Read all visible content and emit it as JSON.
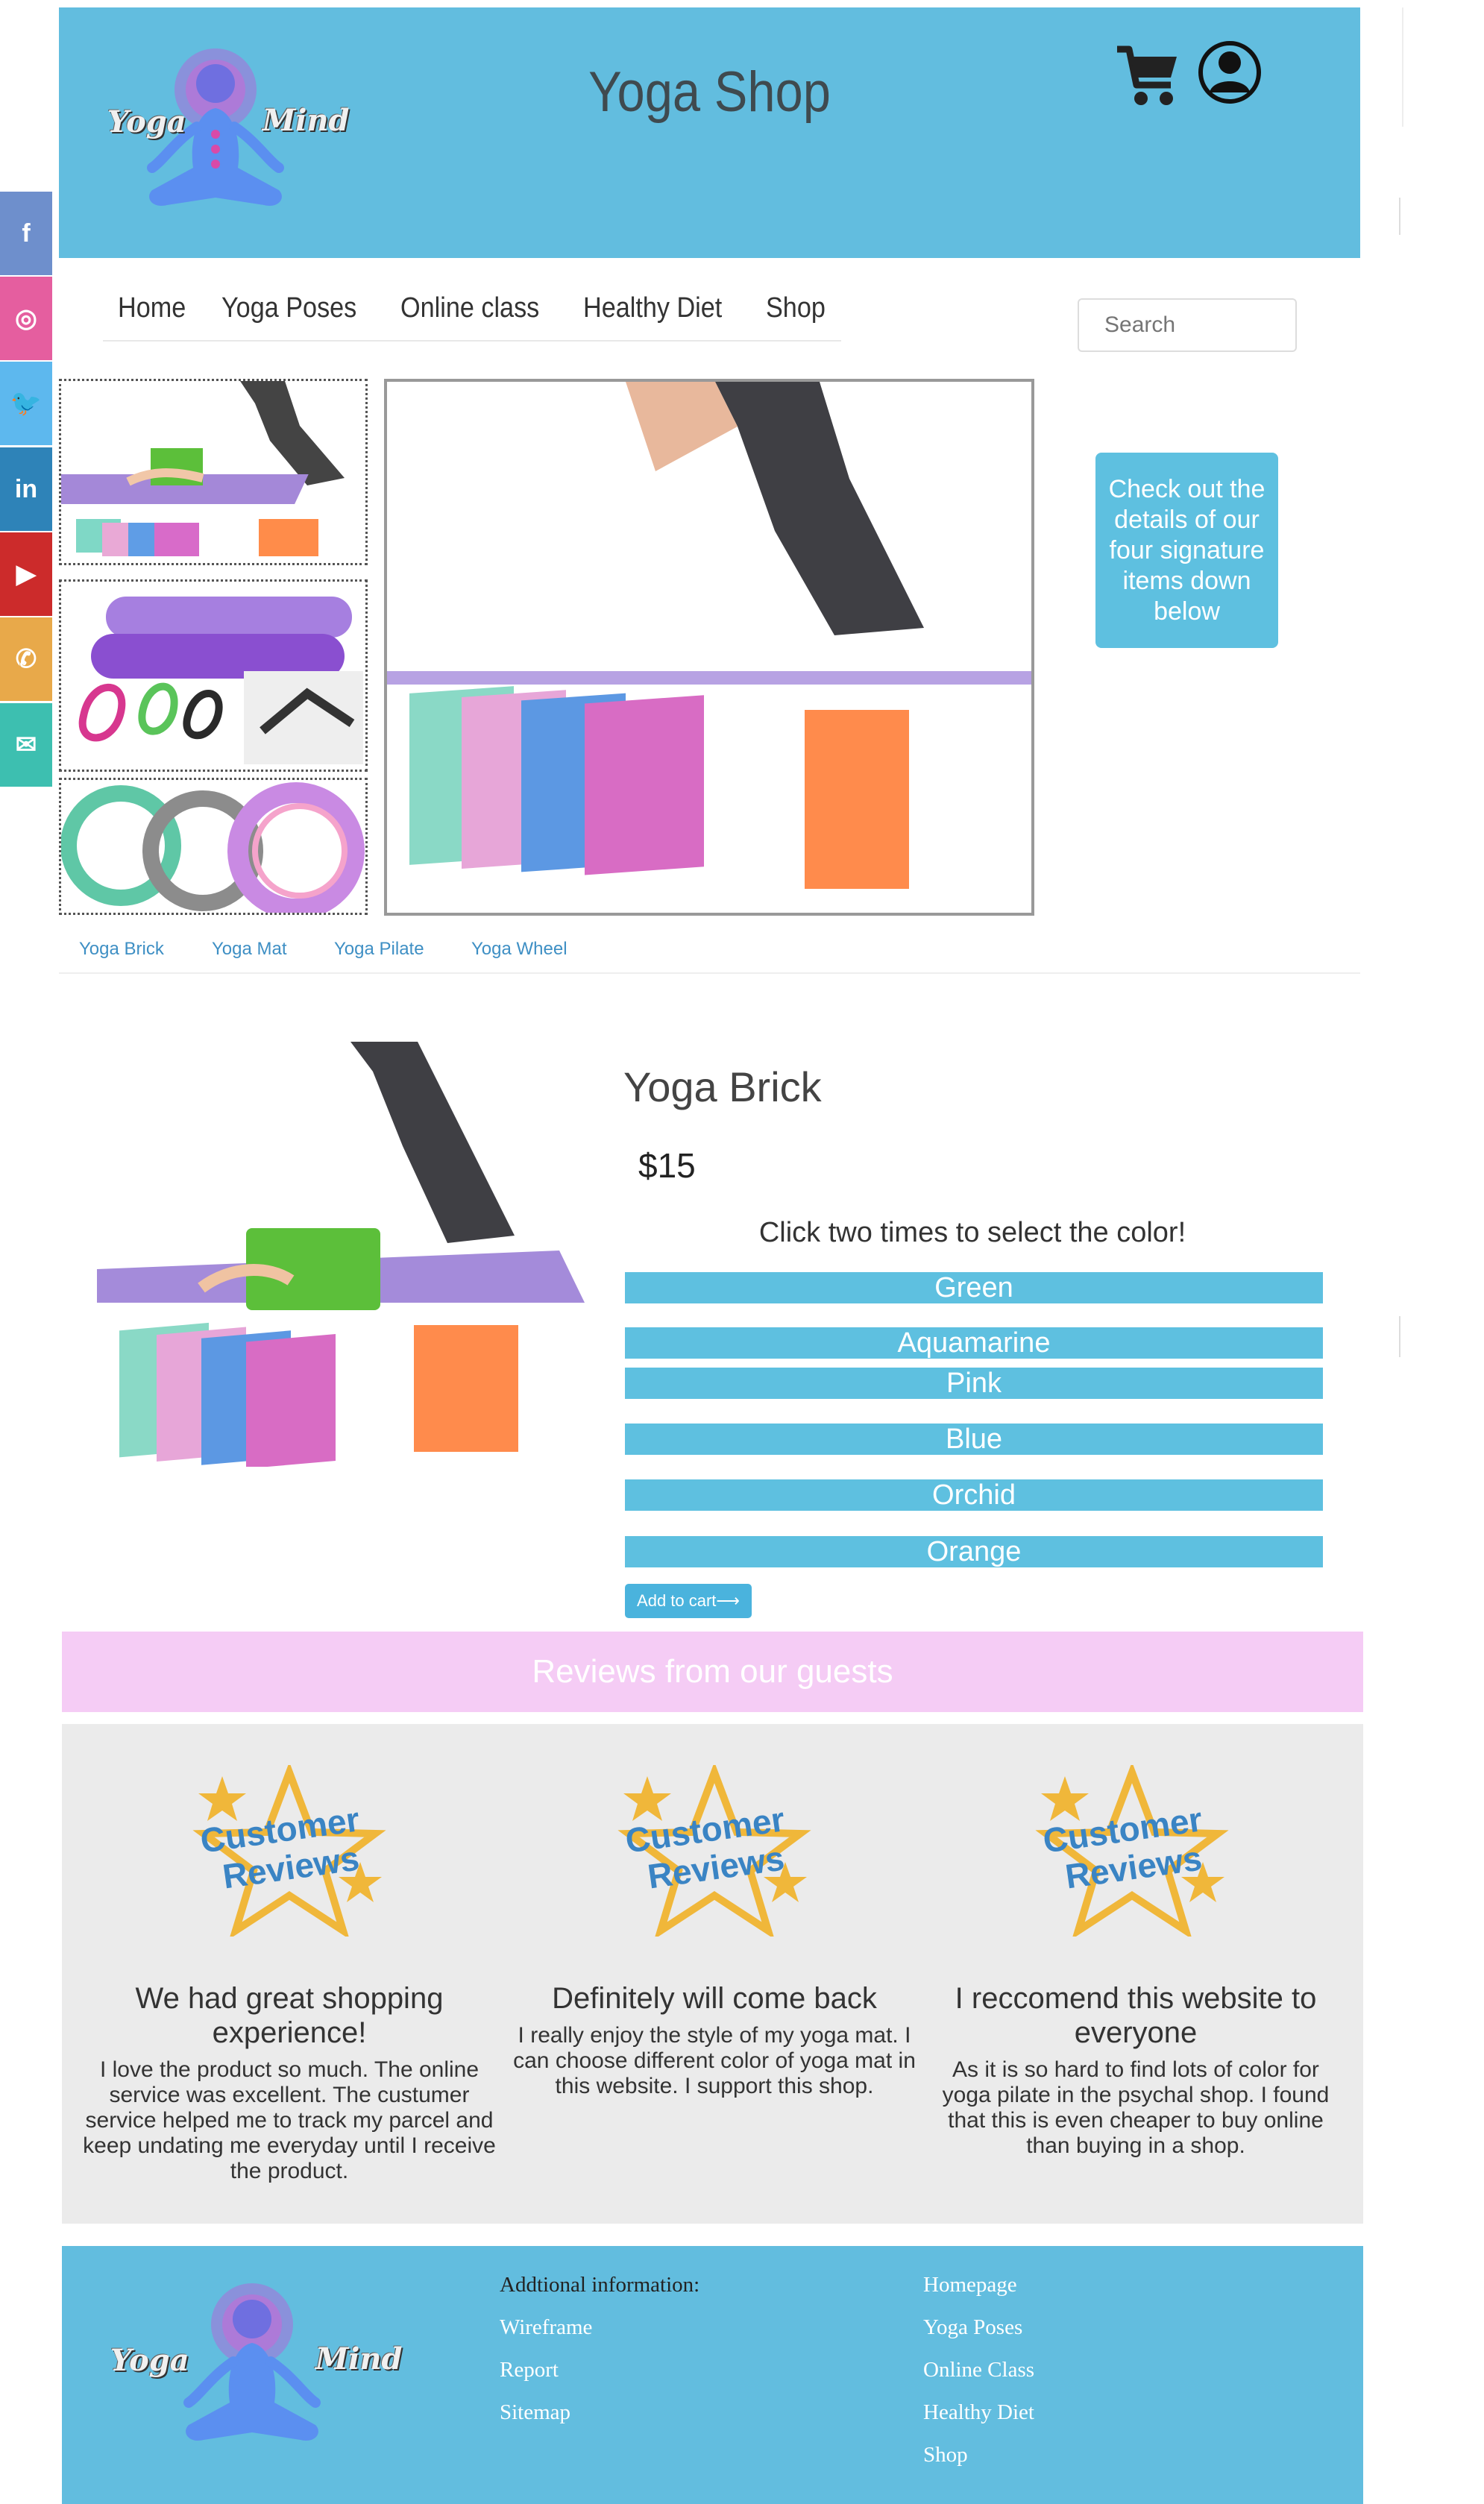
{
  "header": {
    "title": "Yoga Shop",
    "logo_left": "Yoga",
    "logo_right": "Mind",
    "cart_icon": "cart-icon",
    "user_icon": "user-icon",
    "brand_color": "#62bddf"
  },
  "social": [
    {
      "name": "facebook",
      "glyph": "f",
      "color": "#6e8fcc"
    },
    {
      "name": "instagram",
      "glyph": "◎",
      "color": "#e55e9f"
    },
    {
      "name": "twitter",
      "glyph": "🐦",
      "color": "#5db8ee"
    },
    {
      "name": "linkedin",
      "glyph": "in",
      "color": "#2e83b8"
    },
    {
      "name": "youtube",
      "glyph": "▶",
      "color": "#cc2b2b"
    },
    {
      "name": "phone",
      "glyph": "✆",
      "color": "#e8a94a"
    },
    {
      "name": "email",
      "glyph": "✉",
      "color": "#3dbfb0"
    }
  ],
  "nav": {
    "items": [
      "Home",
      "Yoga Poses",
      "Online class",
      "Healthy Diet",
      "Shop"
    ],
    "search_placeholder": "Search"
  },
  "gallery": {
    "info_box": "Check out the details of our four signature items down below",
    "tabs": [
      "Yoga Brick",
      "Yoga Mat",
      "Yoga Pilate",
      "Yoga Wheel"
    ]
  },
  "product": {
    "title": "Yoga Brick",
    "price": "$15",
    "color_hint": "Click two times to select the color!",
    "colors": [
      "Green",
      "Aquamarine",
      "Pink",
      "Blue",
      "Orchid",
      "Orange"
    ],
    "add_to_cart": "Add to cart⟶"
  },
  "reviews": {
    "banner": "Reviews from our guests",
    "badge_line1": "Customer",
    "badge_line2": "Reviews",
    "items": [
      {
        "title": "We had great shopping experience!",
        "body": "I love the product so much. The online service was excellent. The custumer service helped me to track my parcel and keep undating me everyday until I receive the product."
      },
      {
        "title": "Definitely will come back",
        "body": "I really enjoy the style of my yoga mat. I can choose different color of yoga mat in this website. I support this shop."
      },
      {
        "title": "I reccomend this website to everyone",
        "body": "As it is so hard to find lots of color for yoga pilate in the psychal shop. I found that this is even cheaper to buy online than buying in a shop."
      }
    ]
  },
  "footer": {
    "heading": "Addtional information:",
    "col1": [
      "Wireframe",
      "Report",
      "Sitemap"
    ],
    "col2": [
      "Homepage",
      "Yoga Poses",
      "Online Class",
      "Healthy Diet",
      "Shop"
    ]
  }
}
